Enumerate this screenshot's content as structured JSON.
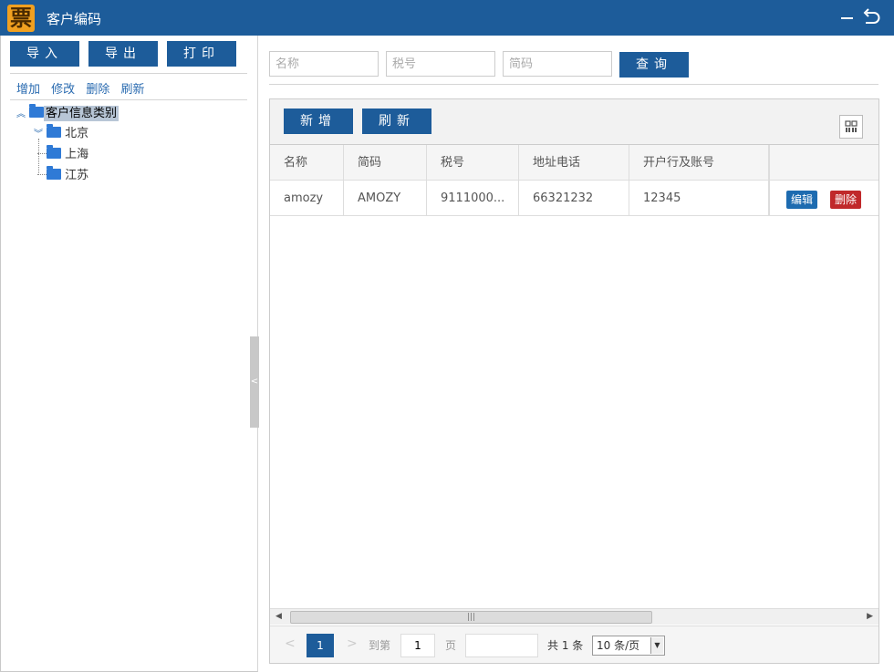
{
  "window": {
    "logo_char": "票",
    "title": "客户编码"
  },
  "left": {
    "import_label": "导入",
    "export_label": "导出",
    "print_label": "打印",
    "links": [
      "增加",
      "修改",
      "删除",
      "刷新"
    ],
    "tree": {
      "root": "客户信息类别",
      "children": [
        "北京",
        "上海",
        "江苏"
      ]
    }
  },
  "search": {
    "name_placeholder": "名称",
    "tax_placeholder": "税号",
    "code_placeholder": "简码",
    "query_label": "查询"
  },
  "grid": {
    "add_label": "新增",
    "refresh_label": "刷新",
    "columns": [
      "名称",
      "简码",
      "税号",
      "地址电话",
      "开户行及账号",
      ""
    ],
    "rows": [
      {
        "name": "amozy",
        "code": "AMOZY",
        "tax": "9111000...",
        "address_phone": "66321232",
        "bank_account": "12345",
        "edit": "编辑",
        "delete": "删除"
      }
    ]
  },
  "pager": {
    "current_page": "1",
    "goto_label": "到第",
    "goto_value": "1",
    "page_label": "页",
    "total": "共 1 条",
    "page_size": "10 条/页"
  }
}
